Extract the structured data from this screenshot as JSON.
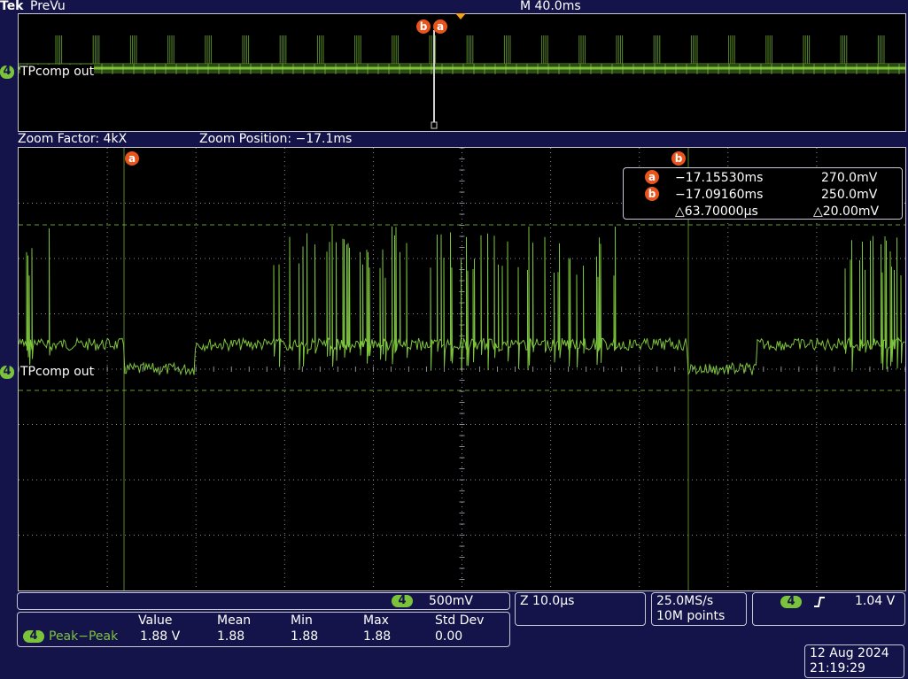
{
  "header": {
    "brand": "Tek",
    "mode": "PreVu",
    "timebase": "M 40.0ms"
  },
  "overview": {
    "channel_num": "4",
    "channel_label": "TPcomp out",
    "cursor_a": "a",
    "cursor_b": "b"
  },
  "zoom": {
    "factor": "Zoom Factor: 4kX",
    "position": "Zoom Position: −17.1ms"
  },
  "main": {
    "channel_num": "4",
    "channel_label": "TPcomp out",
    "cursor_a": "a",
    "cursor_b": "b"
  },
  "cursor_readout": {
    "a_label": "a",
    "a_time": "−17.15530ms",
    "a_volt": "270.0mV",
    "b_label": "b",
    "b_time": "−17.09160ms",
    "b_volt": "250.0mV",
    "delta_time": "△63.70000µs",
    "delta_volt": "△20.00mV"
  },
  "vertical": {
    "channel_num": "4",
    "scale": "500mV"
  },
  "measurement": {
    "headers": [
      "Value",
      "Mean",
      "Min",
      "Max",
      "Std Dev"
    ],
    "channel_num": "4",
    "name": "Peak−Peak",
    "values": [
      "1.88 V",
      "1.88",
      "1.88",
      "1.88",
      "0.00"
    ]
  },
  "horizontal": {
    "zoom_scale": "Z 10.0µs"
  },
  "acquisition": {
    "sample_rate": "25.0MS/s",
    "record_length": "10M points"
  },
  "trigger": {
    "channel_num": "4",
    "slope_icon": "rising-edge-icon",
    "level": "1.04 V"
  },
  "datetime": {
    "date": "12 Aug 2024",
    "time": "21:19:29"
  },
  "colors": {
    "background": "#14144a",
    "waveform": "#7cc33c",
    "cursor": "#e8541c",
    "screen": "#000000"
  }
}
